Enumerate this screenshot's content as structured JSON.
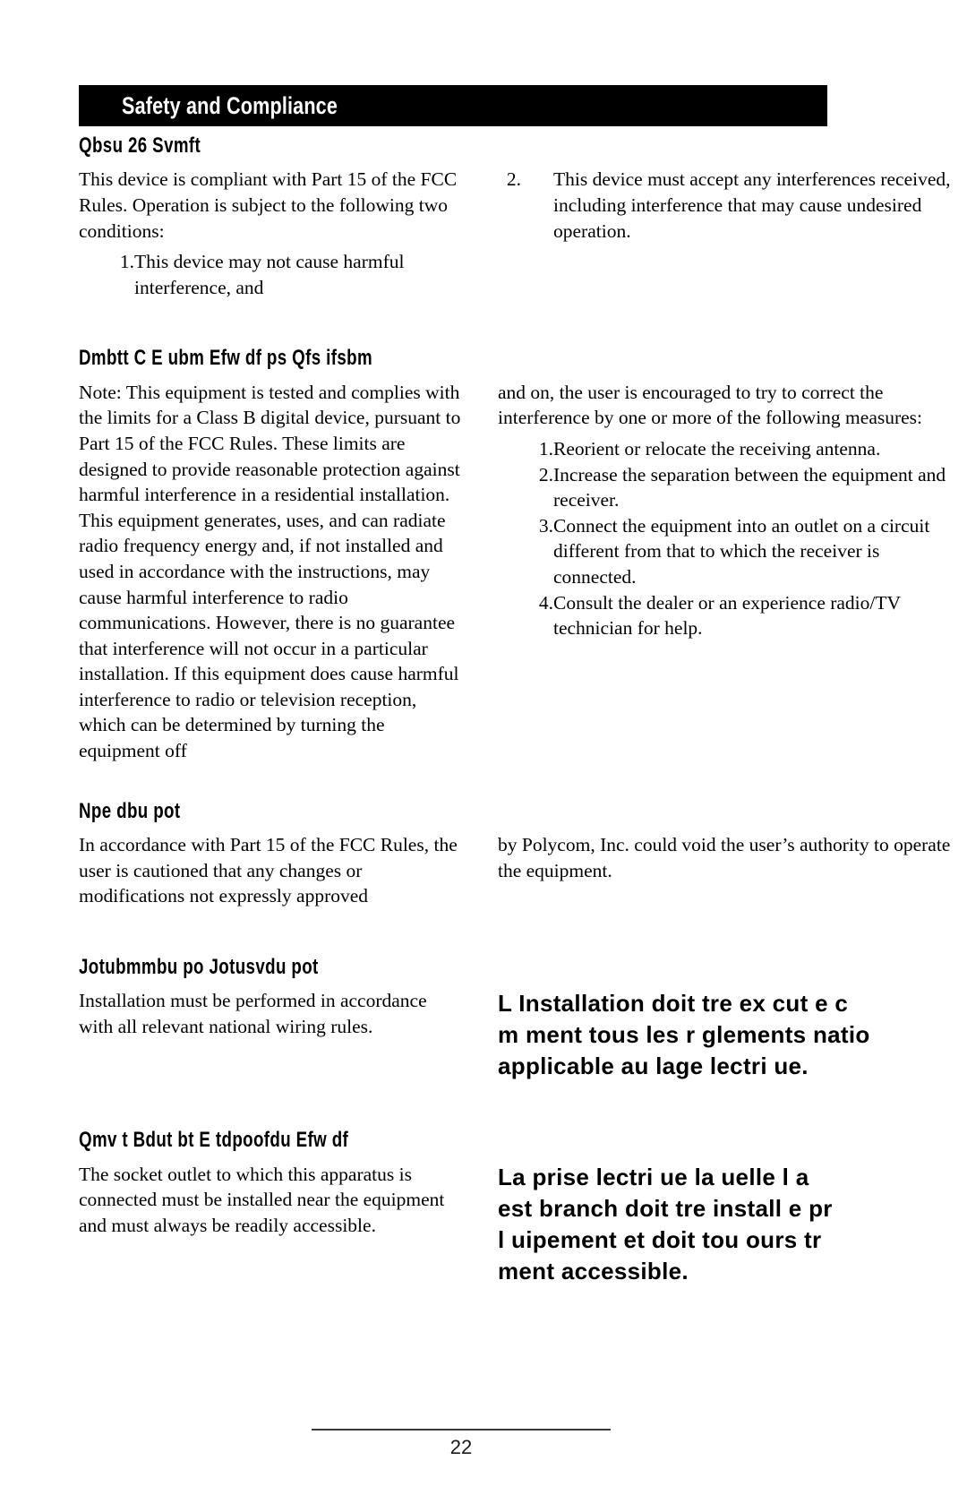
{
  "document": {
    "banner_title": "Safety and Compliance",
    "page_number": "22"
  },
  "sections": [
    {
      "heading": "Qbsu  26  Svmft",
      "left": {
        "paragraphs": [
          "This device is compliant with Part 15 of the FCC Rules.  Operation is subject to the following two conditions:"
        ],
        "list": [
          {
            "num": "1.",
            "text": "This device may not cause harmful interference, and"
          }
        ]
      },
      "right": {
        "list": [
          {
            "num": "2.",
            "text": "This device must accept any interferences received, including interference that may cause undesired operation."
          }
        ]
      }
    },
    {
      "heading": "Dmbtt  C  E          ubm  Efw  df  ps  Qfs      ifsbm",
      "left": {
        "paragraphs": [
          "Note:  This equipment is tested and complies with the limits for a Class B digital device, pursuant to Part 15 of the FCC Rules.  These limits are designed to provide reasonable protection against harmful interference in a residential installation.  This equipment generates, uses, and can radiate radio frequency energy and, if not installed and used in accordance with the instructions, may cause harmful interference to radio communications.  However, there is no guarantee that interference will not occur in a particular installation.  If this equipment does cause harmful interference to radio or television reception, which can be determined by turning the equipment off"
        ]
      },
      "right": {
        "paragraphs": [
          "and on, the user is encouraged to try to correct the interference by one or more of the following measures:"
        ],
        "list": [
          {
            "num": "1.",
            "text": "Reorient or relocate the receiving antenna."
          },
          {
            "num": "2.",
            "text": "Increase the separation between the equipment and receiver."
          },
          {
            "num": "3.",
            "text": "Connect the equipment into an outlet on a circuit different from that to which the receiver is connected."
          },
          {
            "num": "4.",
            "text": "Consult the dealer or an experience radio/TV technician for help."
          }
        ]
      }
    },
    {
      "heading": "Npe        dbu   pot",
      "left": {
        "paragraphs": [
          "In accordance with Part 15 of the FCC Rules, the user is cautioned that any changes or modifications not expressly approved"
        ]
      },
      "right": {
        "paragraphs": [
          "by Polycom, Inc. could void the user’s authority to operate the equipment."
        ]
      }
    },
    {
      "heading": "Jotubmmbu   po  Jotusvdu   pot",
      "left": {
        "paragraphs": [
          "Installation must be performed in accordance with all relevant national wiring rules."
        ]
      },
      "right": {
        "french_lines": [
          "L  Installation doit   tre ex  cut  e c",
          "m  ment     tous les r  glements natio",
          "applicable au    lage    lectri  ue."
        ]
      }
    },
    {
      "heading": "Qmv   t  Bdut  bt  E    tdpoofdu  Efw   df",
      "left": {
        "paragraphs": [
          "The socket outlet to which this apparatus is connected must be installed near the equipment and must always be readily accessible."
        ]
      },
      "right": {
        "french_lines": [
          "La prise    lectri  ue    la  uelle l  a",
          "est branch    doit    tre install   e pr",
          "l       uipement et doit tou  ours  tr",
          "ment accessible."
        ]
      }
    }
  ]
}
